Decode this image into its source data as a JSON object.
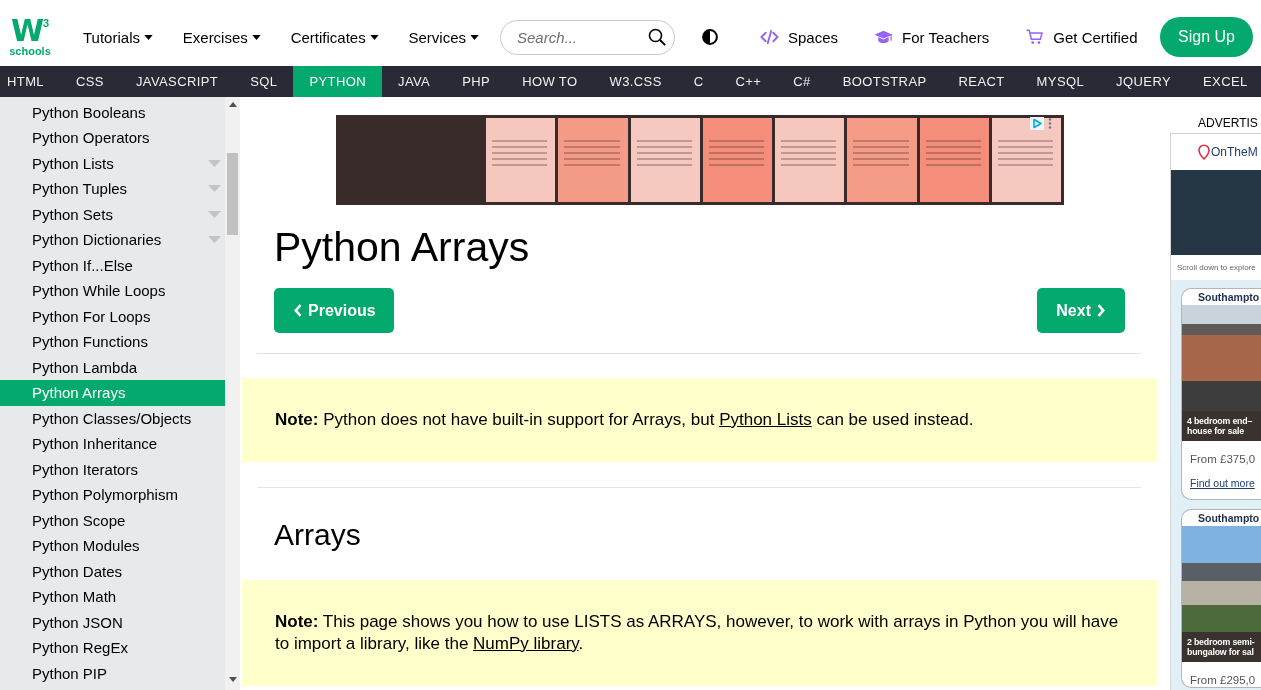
{
  "header": {
    "logo": {
      "mark": "W",
      "sup": "3",
      "word": "schools"
    },
    "menus": [
      {
        "label": "Tutorials"
      },
      {
        "label": "Exercises"
      },
      {
        "label": "Certificates"
      },
      {
        "label": "Services"
      }
    ],
    "search": {
      "placeholder": "Search..."
    },
    "links": [
      {
        "label": "Spaces",
        "kind": "code"
      },
      {
        "label": "For Teachers",
        "kind": "teacher"
      },
      {
        "label": "Get Certified",
        "kind": "cart"
      }
    ],
    "signup": "Sign Up"
  },
  "topnav": [
    {
      "label": "HTML",
      "selected": false
    },
    {
      "label": "CSS",
      "selected": false
    },
    {
      "label": "JAVASCRIPT",
      "selected": false
    },
    {
      "label": "SQL",
      "selected": false
    },
    {
      "label": "PYTHON",
      "selected": true
    },
    {
      "label": "JAVA",
      "selected": false
    },
    {
      "label": "PHP",
      "selected": false
    },
    {
      "label": "HOW TO",
      "selected": false
    },
    {
      "label": "W3.CSS",
      "selected": false
    },
    {
      "label": "C",
      "selected": false
    },
    {
      "label": "C++",
      "selected": false
    },
    {
      "label": "C#",
      "selected": false
    },
    {
      "label": "BOOTSTRAP",
      "selected": false
    },
    {
      "label": "REACT",
      "selected": false
    },
    {
      "label": "MYSQL",
      "selected": false
    },
    {
      "label": "JQUERY",
      "selected": false
    },
    {
      "label": "EXCEL",
      "selected": false
    }
  ],
  "sidebar": {
    "items": [
      {
        "label": "Python Booleans",
        "kind": "link",
        "selected": false
      },
      {
        "label": "Python Operators",
        "kind": "link",
        "selected": false
      },
      {
        "label": "Python Lists",
        "kind": "dropdown",
        "selected": false
      },
      {
        "label": "Python Tuples",
        "kind": "dropdown",
        "selected": false
      },
      {
        "label": "Python Sets",
        "kind": "dropdown",
        "selected": false
      },
      {
        "label": "Python Dictionaries",
        "kind": "dropdown",
        "selected": false
      },
      {
        "label": "Python If...Else",
        "kind": "link",
        "selected": false
      },
      {
        "label": "Python While Loops",
        "kind": "link",
        "selected": false
      },
      {
        "label": "Python For Loops",
        "kind": "link",
        "selected": false
      },
      {
        "label": "Python Functions",
        "kind": "link",
        "selected": false
      },
      {
        "label": "Python Lambda",
        "kind": "link",
        "selected": false
      },
      {
        "label": "Python Arrays",
        "kind": "link",
        "selected": true
      },
      {
        "label": "Python Classes/Objects",
        "kind": "link",
        "selected": false
      },
      {
        "label": "Python Inheritance",
        "kind": "link",
        "selected": false
      },
      {
        "label": "Python Iterators",
        "kind": "link",
        "selected": false
      },
      {
        "label": "Python Polymorphism",
        "kind": "link",
        "selected": false
      },
      {
        "label": "Python Scope",
        "kind": "link",
        "selected": false
      },
      {
        "label": "Python Modules",
        "kind": "link",
        "selected": false
      },
      {
        "label": "Python Dates",
        "kind": "link",
        "selected": false
      },
      {
        "label": "Python Math",
        "kind": "link",
        "selected": false
      },
      {
        "label": "Python JSON",
        "kind": "link",
        "selected": false
      },
      {
        "label": "Python RegEx",
        "kind": "link",
        "selected": false
      },
      {
        "label": "Python PIP",
        "kind": "link",
        "selected": false
      }
    ]
  },
  "main": {
    "title": "Python Arrays",
    "prev": "Previous",
    "next": "Next",
    "note": {
      "before": "**Note:** Python does not have built-in support for Arrays, but ",
      "link": "Python Lists",
      "after": " can be used instead."
    },
    "section": {
      "title": "Arrays",
      "note": {
        "before": "**Note:** This page shows you how to use LISTS as ARRAYS, however, to work with arrays in Python you will have to import a library, like the ",
        "link": "NumPy library",
        "after": "."
      }
    }
  },
  "ad": {
    "label": "ADVERTIS",
    "brand": "OnTheM",
    "hint": "Scroll down to explore",
    "listings": [
      {
        "location": "Southampto",
        "caption": [
          "4 bedroom end–",
          "house for sale"
        ],
        "price": "From £375,0",
        "link": "Find out more"
      },
      {
        "location": "Southampto",
        "caption": [
          "2 bedroom semi-",
          "bungalow for sal"
        ],
        "price": "From £295,0"
      }
    ]
  }
}
